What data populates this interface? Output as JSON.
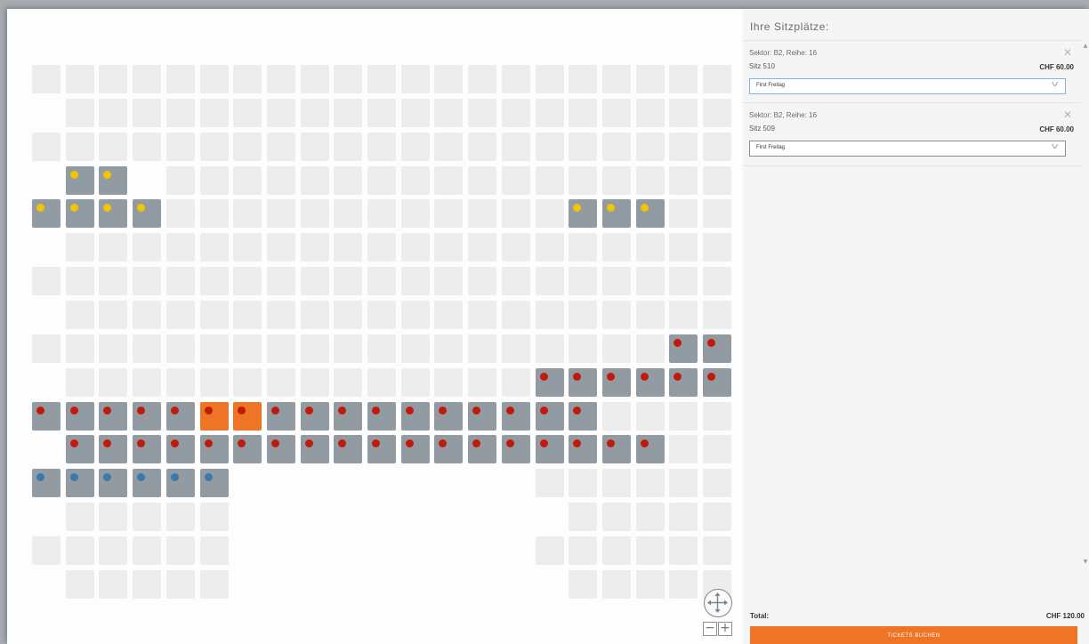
{
  "panel": {
    "title": "Ihre Sitzplätze:",
    "seats": [
      {
        "meta": "Sektor: B2, Reihe: 16",
        "seat": "Sitz 510",
        "price": "CHF 60.00",
        "ticket_type": "First Freitag"
      },
      {
        "meta": "Sektor: B2, Reihe: 16",
        "seat": "Sitz 509",
        "price": "CHF 60.00",
        "ticket_type": "First Freitag"
      }
    ],
    "total_label": "Total:",
    "total_value": "CHF 120.00",
    "book_button": "TICKETS BUCHEN"
  },
  "map": {
    "zoom_out": "−",
    "zoom_in": "+",
    "colors": {
      "free": "#ededed",
      "taken": "#929ba2",
      "selected": "#ee7526",
      "yellow": "#f2c500",
      "red": "#c21a0a",
      "blue": "#3d78ad"
    },
    "rows": [
      ".FFFFFFFFFFFFFFFFFFFFF",
      "..FFFFFFFFFFFFFFFFFFFF",
      ".FFFFFFFFFFFFFFFFFFFFF",
      "..YY.FFFFFFFFFFFFFFFFF",
      ".YYYYFFFFFFFFFFFFYYYFF",
      "..FFFFFFFFFFFFFFFFFFFF",
      ".FFFFFFFFFFFFFFFFFFFFF",
      "..FFFFFFFFFFFFFFFFFFFF",
      ".FFFFFFFFFFFFFFFFFFFRR",
      "..FFFFFFFFFFFFFFRRRRRR",
      ".RRRRRSSRRRRRRRRRRFFFF",
      "..RRRRRRRRRRRRRRRRRRFF",
      ".BBBBBB.........FFFFFF",
      "..FFFFF..........FFFFF",
      ".FFFFFF.........FFFFFF",
      "..FFFFF..........FFFFF"
    ]
  }
}
